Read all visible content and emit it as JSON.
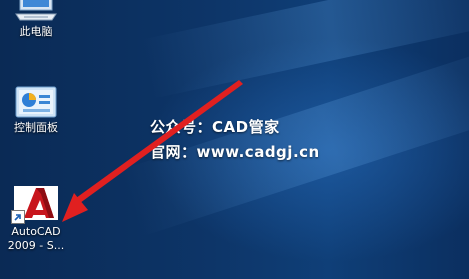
{
  "desktop": {
    "icons": [
      {
        "label": "此电脑",
        "icon": "this-pc-icon"
      },
      {
        "label": "控制面板",
        "icon": "control-panel-icon"
      },
      {
        "label_line1": "AutoCAD",
        "label_line2": "2009 - S...",
        "icon": "autocad-icon"
      }
    ],
    "watermark": {
      "line1": "公众号：CAD管家",
      "line2": "官网：www.cadgj.cn"
    },
    "arrow_color": "#e02020"
  }
}
